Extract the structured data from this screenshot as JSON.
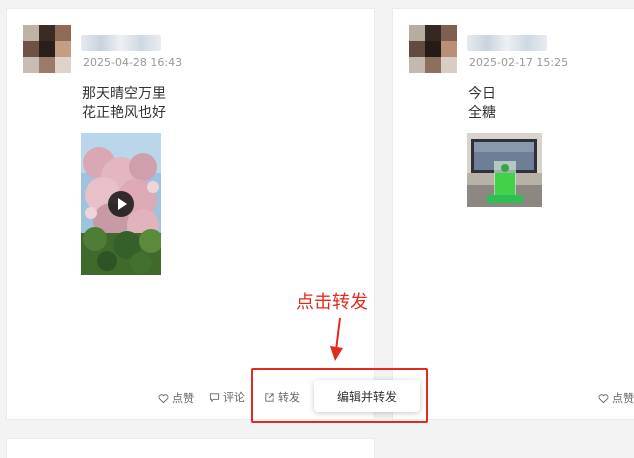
{
  "posts": [
    {
      "time": "2025-04-28 16:43",
      "lines": [
        "那天晴空万里",
        "花正艳风也好"
      ],
      "media": "video",
      "actions": {
        "like": "点赞",
        "comment": "评论",
        "share": "转发"
      },
      "popup_option": "编辑并转发"
    },
    {
      "time": "2025-02-17 15:25",
      "lines": [
        "今日",
        "全糖"
      ],
      "media": "image",
      "actions": {
        "like": "点赞"
      }
    }
  ],
  "annotation": {
    "text": "点击转发",
    "color": "#e02b1f"
  },
  "icons": {
    "like": "heart-icon",
    "comment": "comment-icon",
    "share": "share-icon",
    "play": "play-icon"
  }
}
